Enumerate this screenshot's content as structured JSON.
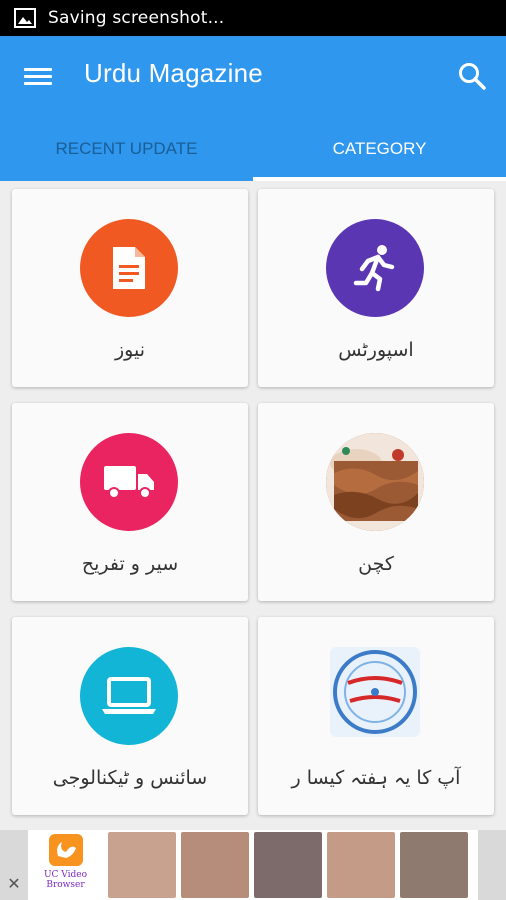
{
  "status_bar": {
    "notification_text": "Saving screenshot...",
    "icon": "image-icon"
  },
  "app_bar": {
    "title": "Urdu Magazine",
    "menu_icon": "hamburger-menu-icon",
    "search_icon": "search-icon",
    "color": "#2f97ee"
  },
  "tabs": [
    {
      "label": "RECENT UPDATE",
      "active": false
    },
    {
      "label": "CATEGORY",
      "active": true
    }
  ],
  "categories": [
    {
      "label": "نیوز",
      "icon": "document-icon",
      "color": "#f05a22"
    },
    {
      "label": "اسپورٹس",
      "icon": "running-person-icon",
      "color": "#5b36b3"
    },
    {
      "label": "سیر و تفریح",
      "icon": "truck-icon",
      "color": "#ea2461"
    },
    {
      "label": "کچن",
      "icon": "kebab-food-image",
      "color": "#a0522d"
    },
    {
      "label": "سائنس و ٹیکنالوجی",
      "icon": "laptop-icon",
      "color": "#12b5d6"
    },
    {
      "label": "آپ کا یہ ہفتہ کیسا ر",
      "icon": "horoscope-image",
      "color": "#3b7bc8"
    }
  ],
  "ad": {
    "brand_line1": "UC Video",
    "brand_line2": "Browser",
    "close_label": "✕"
  }
}
